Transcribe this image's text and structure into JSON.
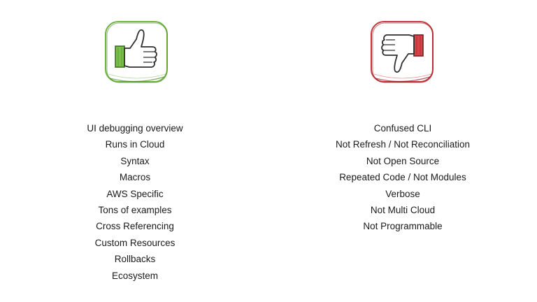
{
  "pros": {
    "icon": "thumbs-up-icon",
    "color": "#6db33f",
    "items": [
      "UI debugging overview",
      "Runs in Cloud",
      "Syntax",
      "Macros",
      "AWS Specific",
      "Tons of examples",
      "Cross Referencing",
      "Custom Resources",
      "Rollbacks",
      "Ecosystem"
    ]
  },
  "cons": {
    "icon": "thumbs-down-icon",
    "color": "#c9353a",
    "items": [
      "Confused CLI",
      "Not Refresh / Not Reconciliation",
      "Not Open Source",
      "Repeated Code / Not Modules",
      "Verbose",
      "Not Multi Cloud",
      "Not Programmable"
    ]
  }
}
